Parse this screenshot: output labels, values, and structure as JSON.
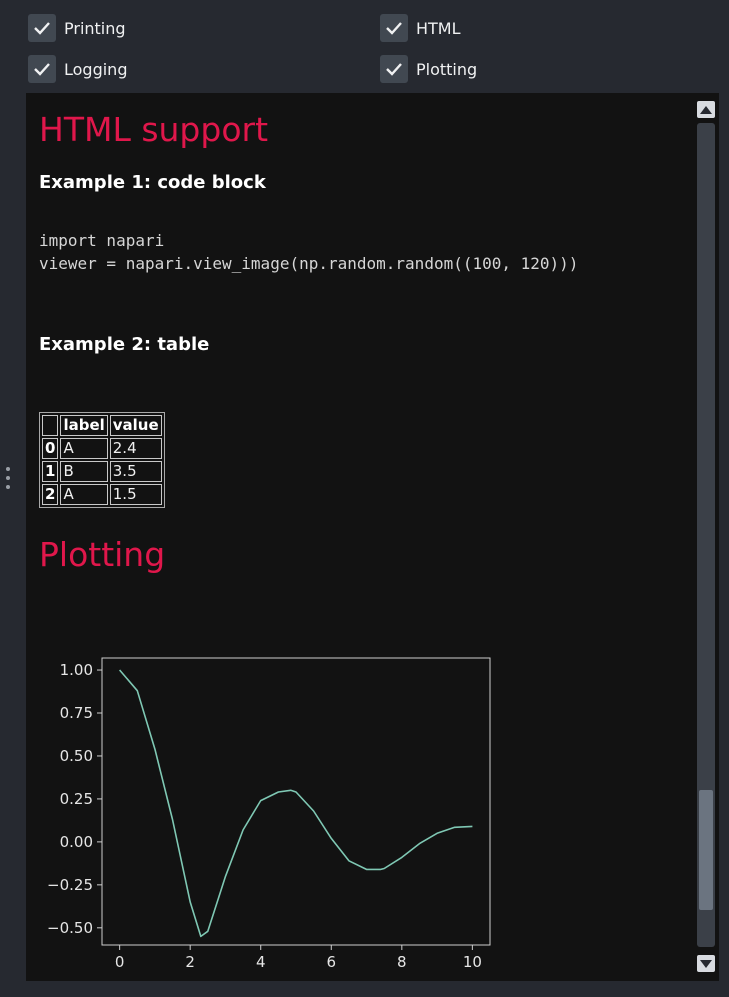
{
  "options": [
    {
      "label": "Printing",
      "checked": true
    },
    {
      "label": "HTML",
      "checked": true
    },
    {
      "label": "Logging",
      "checked": true
    },
    {
      "label": "Plotting",
      "checked": true
    }
  ],
  "console": {
    "html_heading": "HTML support",
    "example1_heading": "Example 1: code block",
    "code_line1": "import napari",
    "code_line2": "viewer = napari.view_image(np.random.random((100, 120)))",
    "example2_heading": "Example 2: table",
    "table": {
      "columns": [
        "",
        "label",
        "value"
      ],
      "rows": [
        [
          "0",
          "A",
          "2.4"
        ],
        [
          "1",
          "B",
          "3.5"
        ],
        [
          "2",
          "A",
          "1.5"
        ]
      ]
    },
    "plotting_heading": "Plotting"
  },
  "scroll": {
    "position": 0.95
  },
  "colors": {
    "accent": "#e0174b",
    "line": "#7fc8b4",
    "background": "#121212"
  },
  "chart_data": {
    "type": "line",
    "title": "",
    "xlabel": "",
    "ylabel": "",
    "xlim": [
      -0.5,
      10.5
    ],
    "ylim": [
      -0.6,
      1.07
    ],
    "xticks": [
      "0",
      "2",
      "4",
      "6",
      "8",
      "10"
    ],
    "yticks": [
      "1.00",
      "0.75",
      "0.50",
      "0.25",
      "0.00",
      "−0.25",
      "−0.50"
    ],
    "series": [
      {
        "x": [
          0,
          0.5,
          1,
          1.5,
          2,
          2.3,
          2.5,
          3,
          3.5,
          4,
          4.5,
          4.85,
          5,
          5.5,
          6,
          6.5,
          7,
          7.4,
          7.5,
          8,
          8.5,
          9,
          9.5,
          10
        ],
        "y": [
          1.0,
          0.88,
          0.54,
          0.13,
          -0.35,
          -0.55,
          -0.52,
          -0.2,
          0.07,
          0.24,
          0.29,
          0.3,
          0.29,
          0.18,
          0.02,
          -0.11,
          -0.16,
          -0.16,
          -0.155,
          -0.09,
          -0.01,
          0.05,
          0.085,
          0.09
        ]
      }
    ]
  }
}
